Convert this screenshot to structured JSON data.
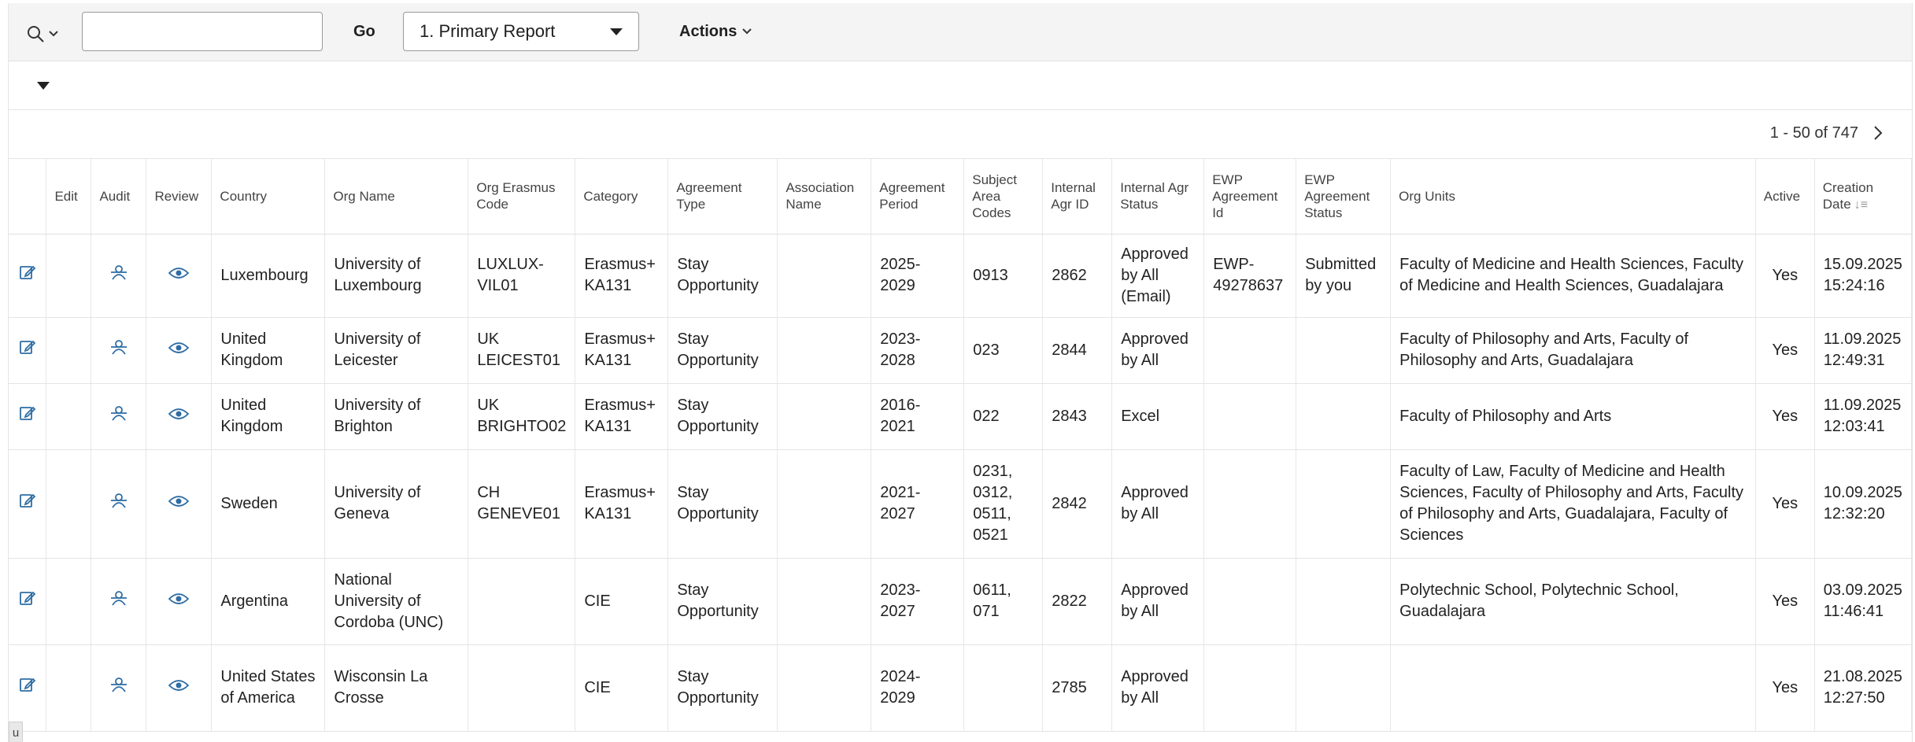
{
  "toolbar": {
    "search_value": "",
    "go_label": "Go",
    "report_selected": "1. Primary Report",
    "actions_label": "Actions"
  },
  "pager": {
    "range_text": "1 - 50 of 747"
  },
  "columns": {
    "edit": "Edit",
    "audit": "Audit",
    "review": "Review",
    "country": "Country",
    "org_name": "Org Name",
    "org_erasmus_code": "Org Erasmus Code",
    "category": "Category",
    "agreement_type": "Agreement Type",
    "association_name": "Association Name",
    "agreement_period": "Agreement Period",
    "subject_area_codes": "Subject Area Codes",
    "internal_agr_id": "Internal Agr ID",
    "internal_agr_status": "Internal Agr Status",
    "ewp_agreement_id": "EWP Agreement Id",
    "ewp_agreement_status": "EWP Agreement Status",
    "org_units": "Org Units",
    "active": "Active",
    "creation_date": "Creation Date"
  },
  "rows": [
    {
      "country": "Luxembourg",
      "org_name": "University of Luxembourg",
      "org_erasmus_code": "LUXLUX-VIL01",
      "category": "Erasmus+ KA131",
      "agreement_type": "Stay Opportunity",
      "association_name": "",
      "agreement_period": "2025-2029",
      "subject_area_codes": "0913",
      "internal_agr_id": "2862",
      "internal_agr_status": "Approved by All (Email)",
      "ewp_agreement_id": "EWP-49278637",
      "ewp_agreement_status": "Submitted by you",
      "org_units": "Faculty of Medicine and Health Sciences, Faculty of Medicine and Health Sciences, Guadalajara",
      "active": "Yes",
      "creation_date": "15.09.2025 15:24:16"
    },
    {
      "country": "United Kingdom",
      "org_name": "University of Leicester",
      "org_erasmus_code": "UK LEICEST01",
      "category": "Erasmus+ KA131",
      "agreement_type": "Stay Opportunity",
      "association_name": "",
      "agreement_period": "2023-2028",
      "subject_area_codes": "023",
      "internal_agr_id": "2844",
      "internal_agr_status": "Approved by All",
      "ewp_agreement_id": "",
      "ewp_agreement_status": "",
      "org_units": "Faculty of Philosophy and Arts, Faculty of Philosophy and Arts, Guadalajara",
      "active": "Yes",
      "creation_date": "11.09.2025 12:49:31"
    },
    {
      "country": "United Kingdom",
      "org_name": "University of Brighton",
      "org_erasmus_code": "UK BRIGHTO02",
      "category": "Erasmus+ KA131",
      "agreement_type": "Stay Opportunity",
      "association_name": "",
      "agreement_period": "2016-2021",
      "subject_area_codes": "022",
      "internal_agr_id": "2843",
      "internal_agr_status": "Excel",
      "ewp_agreement_id": "",
      "ewp_agreement_status": "",
      "org_units": "Faculty of Philosophy and Arts",
      "active": "Yes",
      "creation_date": "11.09.2025 12:03:41"
    },
    {
      "country": "Sweden",
      "org_name": "University of Geneva",
      "org_erasmus_code": "CH GENEVE01",
      "category": "Erasmus+ KA131",
      "agreement_type": "Stay Opportunity",
      "association_name": "",
      "agreement_period": "2021-2027",
      "subject_area_codes": "0231, 0312, 0511, 0521",
      "internal_agr_id": "2842",
      "internal_agr_status": "Approved by All",
      "ewp_agreement_id": "",
      "ewp_agreement_status": "",
      "org_units": "Faculty of Law, Faculty of Medicine and Health Sciences, Faculty of Philosophy and Arts, Faculty of Philosophy and Arts, Guadalajara, Faculty of Sciences",
      "active": "Yes",
      "creation_date": "10.09.2025 12:32:20"
    },
    {
      "country": "Argentina",
      "org_name": "National University of Cordoba (UNC)",
      "org_erasmus_code": "",
      "category": "CIE",
      "agreement_type": "Stay Opportunity",
      "association_name": "",
      "agreement_period": "2023-2027",
      "subject_area_codes": "0611, 071",
      "internal_agr_id": "2822",
      "internal_agr_status": "Approved by All",
      "ewp_agreement_id": "",
      "ewp_agreement_status": "",
      "org_units": "Polytechnic School, Polytechnic School, Guadalajara",
      "active": "Yes",
      "creation_date": "03.09.2025 11:46:41"
    },
    {
      "country": "United States of America",
      "org_name": "Wisconsin La Crosse",
      "org_erasmus_code": "",
      "category": "CIE",
      "agreement_type": "Stay Opportunity",
      "association_name": "",
      "agreement_period": "2024-2029",
      "subject_area_codes": "",
      "internal_agr_id": "2785",
      "internal_agr_status": "Approved by All",
      "ewp_agreement_id": "",
      "ewp_agreement_status": "",
      "org_units": "",
      "active": "Yes",
      "creation_date": "21.08.2025 12:27:50"
    }
  ],
  "corner_badge": "u",
  "colors": {
    "link": "#1f5d9e",
    "icon": "#2e6da4",
    "toolbar_bg": "#f4f4f4"
  }
}
